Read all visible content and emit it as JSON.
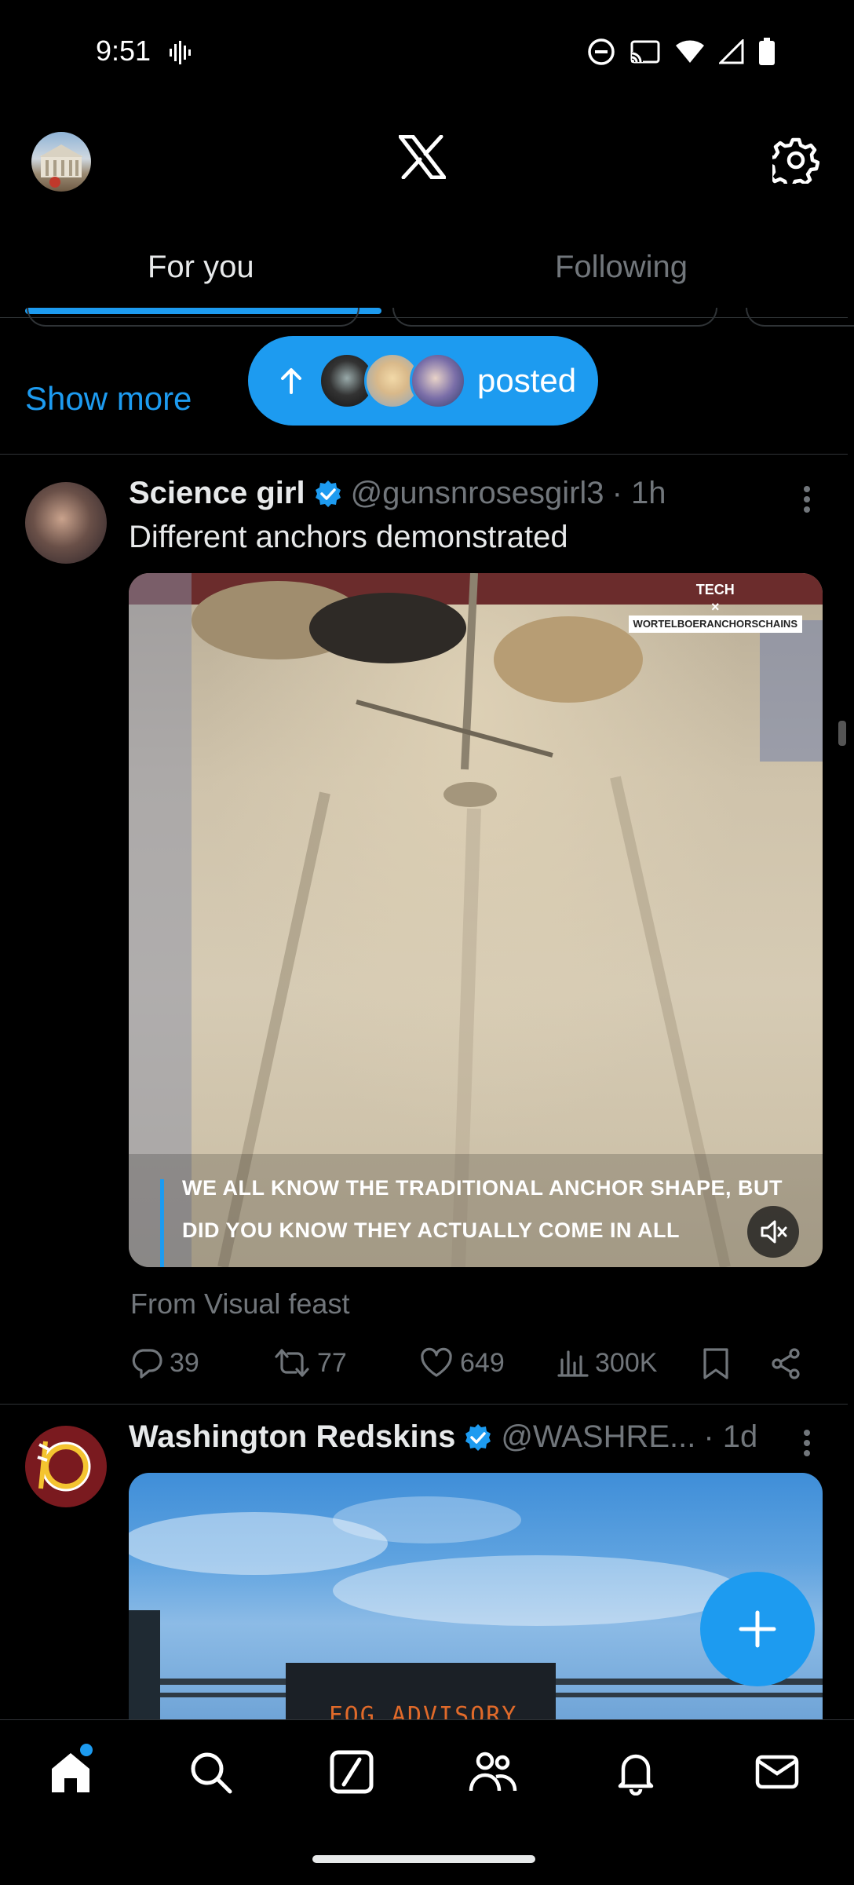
{
  "status_bar": {
    "time": "9:51"
  },
  "tabs": [
    {
      "label": "For you",
      "selected": true
    },
    {
      "label": "Following",
      "selected": false
    }
  ],
  "feed": {
    "show_more": "Show more",
    "new_posts_pill": {
      "label": "posted"
    }
  },
  "tweets": [
    {
      "name": "Science girl",
      "verified": true,
      "handle": "@gunsnrosesgirl3",
      "time": "· 1h",
      "text": "Different anchors demonstrated",
      "media": {
        "caption_line1": "WE ALL KNOW THE TRADITIONAL ANCHOR SHAPE, BUT",
        "caption_line2": "DID YOU KNOW THEY ACTUALLY COME IN ALL",
        "watermark_line1": "TECH",
        "watermark_line2": "×",
        "watermark_line3": "WORTELBOERANCHORSCHAINS"
      },
      "source": "From Visual feast",
      "replies": "39",
      "reposts": "77",
      "likes": "649",
      "views": "300K"
    },
    {
      "name": "Washington Redskins",
      "verified": true,
      "handle": "@WASHRE...",
      "time": "· 1d",
      "media_sign_text": "FOG ADVISORY"
    }
  ],
  "colors": {
    "accent": "#1d9bf0",
    "background": "#000000",
    "secondary_text": "#71767b"
  }
}
